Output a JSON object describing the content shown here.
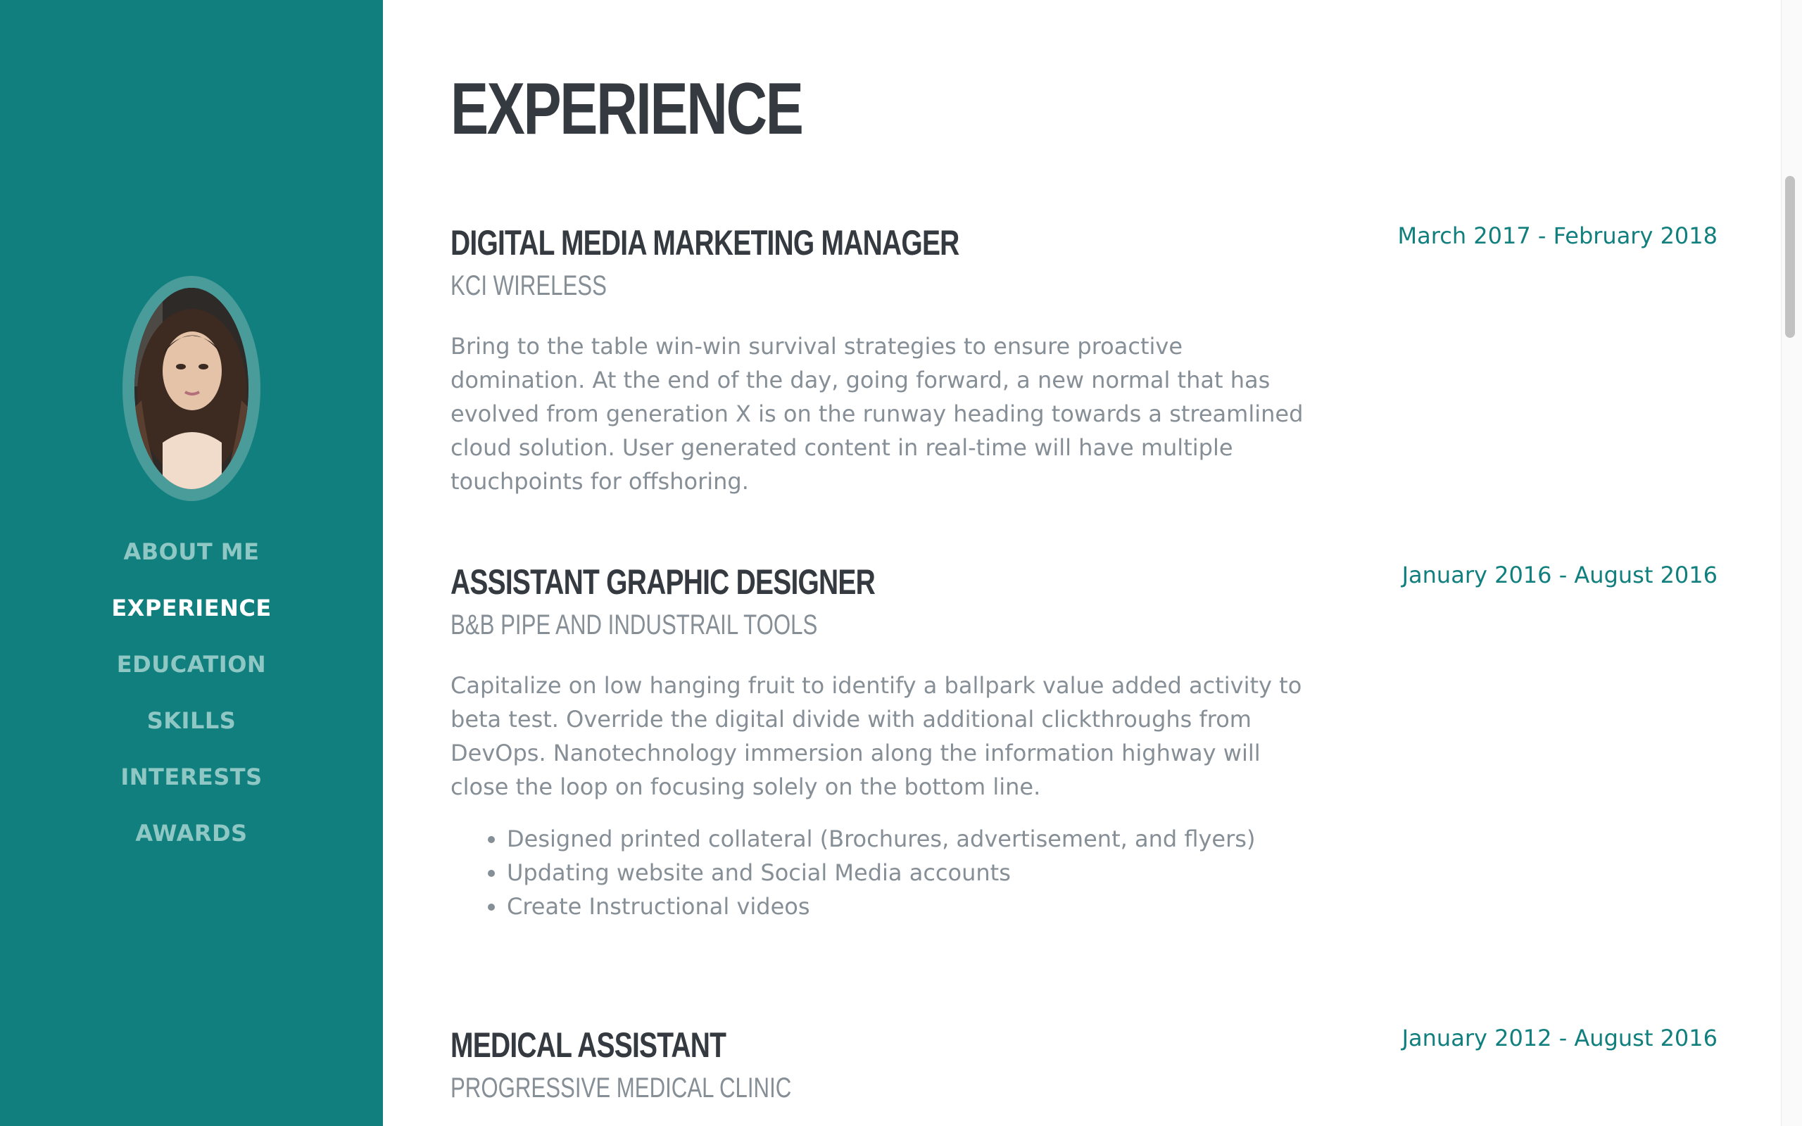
{
  "sidebar": {
    "avatar_alt": "profile photo",
    "nav": [
      {
        "label": "ABOUT ME",
        "active": false
      },
      {
        "label": "EXPERIENCE",
        "active": true
      },
      {
        "label": "EDUCATION",
        "active": false
      },
      {
        "label": "SKILLS",
        "active": false
      },
      {
        "label": "INTERESTS",
        "active": false
      },
      {
        "label": "AWARDS",
        "active": false
      }
    ]
  },
  "main": {
    "title": "EXPERIENCE",
    "jobs": [
      {
        "title": "DIGITAL MEDIA MARKETING MANAGER",
        "company": "KCI WIRELESS",
        "date": "March 2017 - February 2018",
        "description": "Bring to the table win-win survival strategies to ensure proactive domination. At the end of the day, going forward, a new normal that has evolved from generation X is on the runway heading towards a streamlined cloud solution. User generated content in real-time will have multiple touchpoints for offshoring.",
        "bullets": []
      },
      {
        "title": "ASSISTANT GRAPHIC DESIGNER",
        "company": "B&B PIPE AND INDUSTRAIL TOOLS",
        "date": "January 2016 - August 2016",
        "description": "Capitalize on low hanging fruit to identify a ballpark value added activity to beta test. Override the digital divide with additional clickthroughs from DevOps. Nanotechnology immersion along the information highway will close the loop on focusing solely on the bottom line.",
        "bullets": [
          "Designed printed collateral (Brochures, advertisement, and flyers)",
          "Updating website and Social Media accounts",
          "Create Instructional videos"
        ]
      },
      {
        "title": "MEDICAL ASSISTANT",
        "company": "PROGRESSIVE MEDICAL CLINIC",
        "date": "January 2012 - August 2016",
        "description": "",
        "bullets": []
      }
    ]
  },
  "colors": {
    "sidebar_bg": "#117f7d",
    "accent": "#117f7d",
    "heading": "#343a40",
    "muted": "#868e96",
    "nav_inactive": "#8fc7c5",
    "nav_active": "#ffffff"
  }
}
